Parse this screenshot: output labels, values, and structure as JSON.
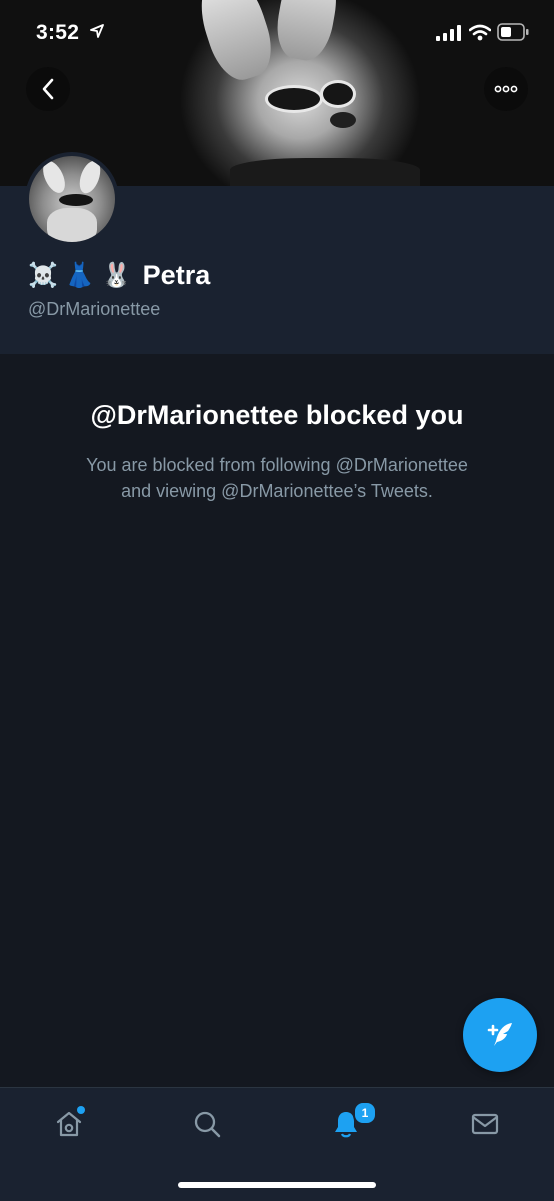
{
  "status_bar": {
    "time": "3:52"
  },
  "header": {
    "back_icon": "chevron-left-icon",
    "more_icon": "more-horizontal-icon"
  },
  "profile": {
    "emojis": [
      "☠️",
      "👗",
      "🐰"
    ],
    "name": "Petra",
    "handle": "@DrMarionettee"
  },
  "blocked": {
    "title": "@DrMarionettee blocked you",
    "line1": "You are blocked from following @DrMarionettee",
    "line2": "and viewing @DrMarionettee’s Tweets."
  },
  "compose": {
    "icon": "compose-feather-icon"
  },
  "tab_bar": {
    "tabs": [
      {
        "name": "home",
        "icon": "home-icon",
        "has_dot": true
      },
      {
        "name": "search",
        "icon": "search-icon"
      },
      {
        "name": "notifications",
        "icon": "bell-icon",
        "active": true,
        "badge": "1"
      },
      {
        "name": "messages",
        "icon": "mail-icon"
      }
    ]
  },
  "colors": {
    "accent": "#1da1f2",
    "background": "#141820",
    "panel": "#1a2230",
    "secondary_text": "#8899a6"
  }
}
